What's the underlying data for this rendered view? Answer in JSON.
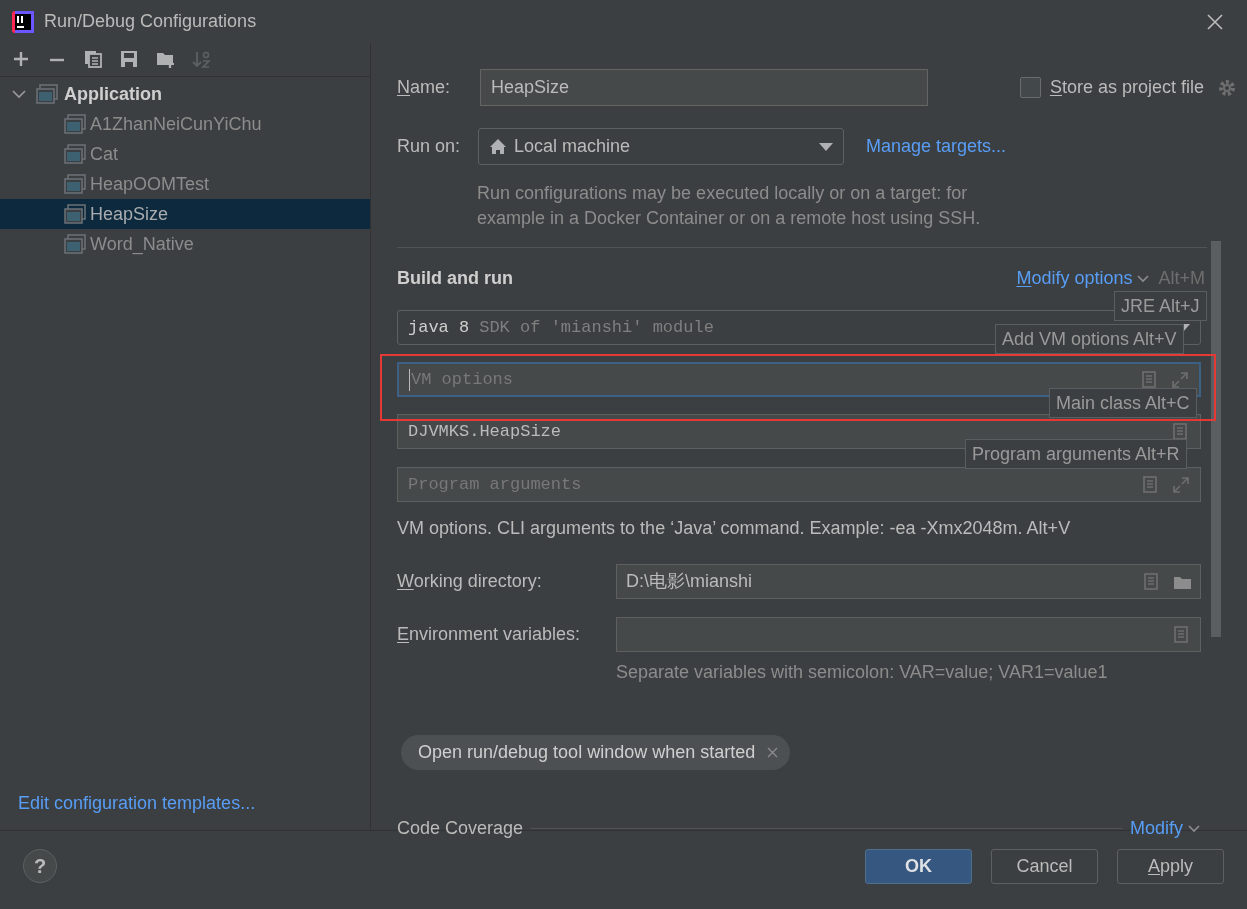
{
  "window": {
    "title": "Run/Debug Configurations"
  },
  "toolbar": [
    {
      "kind": "add",
      "disabled": false
    },
    {
      "kind": "remove",
      "disabled": false
    },
    {
      "kind": "copy",
      "disabled": false
    },
    {
      "kind": "save",
      "disabled": false
    },
    {
      "kind": "folder",
      "disabled": false
    },
    {
      "kind": "sort",
      "disabled": true
    }
  ],
  "tree": {
    "label": "Application",
    "expanded": true,
    "children": [
      {
        "label": "A1ZhanNeiCunYiChu",
        "selected": false
      },
      {
        "label": "Cat",
        "selected": false
      },
      {
        "label": "HeapOOMTest",
        "selected": false
      },
      {
        "label": "HeapSize",
        "selected": true
      },
      {
        "label": "Word_Native",
        "selected": false
      }
    ]
  },
  "templates_link": "Edit configuration templates...",
  "name": {
    "mnemonic": "N",
    "label_rest": "ame:",
    "value": "HeapSize"
  },
  "store_as_project_file": {
    "mnemonic": "S",
    "label_rest": "tore as project file",
    "checked": false
  },
  "run_on": {
    "label": "Run on:",
    "value": "Local machine",
    "link": "Manage targets...",
    "description": "Run configurations may be executed locally or on a target: for example in a Docker Container or on a remote host using SSH."
  },
  "build_and_run": {
    "title": "Build and run",
    "modify": {
      "mnemonic": "M",
      "label_rest": "odify options",
      "shortcut": "Alt+M"
    },
    "jre": {
      "value": "java 8",
      "hint": "SDK of 'mianshi' module"
    },
    "vm_options": {
      "placeholder": "VM options",
      "focused": true
    },
    "main_class": {
      "value": "DJVMKS.HeapSize"
    },
    "program_arguments": {
      "placeholder": "Program arguments"
    },
    "help": "VM options. CLI arguments to the ‘Java’ command. Example: -ea -Xmx2048m. Alt+V"
  },
  "working_directory": {
    "mnemonic": "W",
    "label_rest": "orking directory:",
    "value": "D:\\电影\\mianshi"
  },
  "environment_variables": {
    "mnemonic": "E",
    "label_rest": "nvironment variables:",
    "help": "Separate variables with semicolon: VAR=value; VAR1=value1"
  },
  "chip": {
    "label": "Open run/debug tool window when started"
  },
  "code_coverage": {
    "title": "Code Coverage",
    "link": "Modify"
  },
  "hints": [
    {
      "text": "JRE Alt+J"
    },
    {
      "text": "Add VM options Alt+V"
    },
    {
      "text": "Main class Alt+C"
    },
    {
      "text": "Program arguments Alt+R"
    }
  ],
  "help_button": "?",
  "buttons": [
    {
      "label": "OK",
      "kind": "default"
    },
    {
      "label": "Cancel",
      "kind": "normal"
    },
    {
      "mnemonic": "A",
      "label_rest": "pply",
      "kind": "normal"
    }
  ]
}
